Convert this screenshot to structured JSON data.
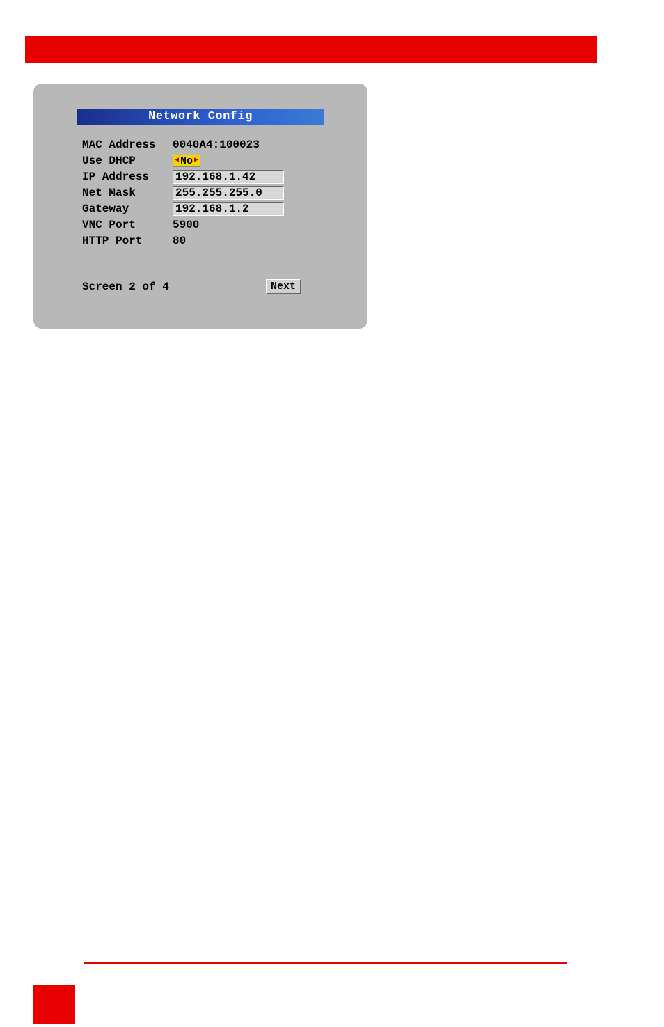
{
  "dialog": {
    "title": "Network Config",
    "fields": {
      "mac_label": "MAC Address",
      "mac_value": "0040A4:100023",
      "dhcp_label": "Use DHCP",
      "dhcp_value": "No",
      "ip_label": "IP Address",
      "ip_value": "192.168.1.42",
      "mask_label": "Net Mask",
      "mask_value": "255.255.255.0",
      "gw_label": "Gateway",
      "gw_value": "192.168.1.2",
      "vnc_label": "VNC Port",
      "vnc_value": "5900",
      "http_label": "HTTP Port",
      "http_value": "80"
    },
    "screen_count": "Screen 2 of 4",
    "next_label": "Next"
  }
}
